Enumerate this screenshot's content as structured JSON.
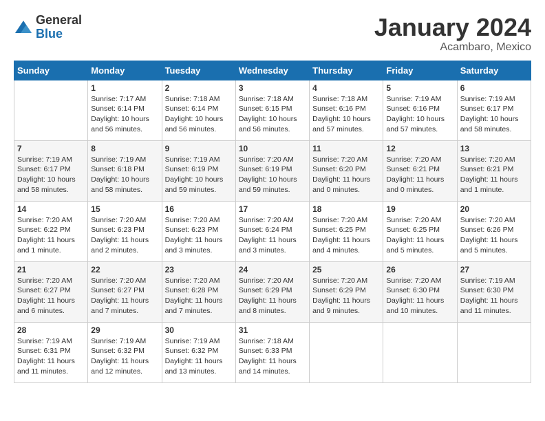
{
  "logo": {
    "general": "General",
    "blue": "Blue"
  },
  "title": "January 2024",
  "subtitle": "Acambaro, Mexico",
  "days_header": [
    "Sunday",
    "Monday",
    "Tuesday",
    "Wednesday",
    "Thursday",
    "Friday",
    "Saturday"
  ],
  "weeks": [
    [
      {
        "num": "",
        "info": ""
      },
      {
        "num": "1",
        "info": "Sunrise: 7:17 AM\nSunset: 6:14 PM\nDaylight: 10 hours\nand 56 minutes."
      },
      {
        "num": "2",
        "info": "Sunrise: 7:18 AM\nSunset: 6:14 PM\nDaylight: 10 hours\nand 56 minutes."
      },
      {
        "num": "3",
        "info": "Sunrise: 7:18 AM\nSunset: 6:15 PM\nDaylight: 10 hours\nand 56 minutes."
      },
      {
        "num": "4",
        "info": "Sunrise: 7:18 AM\nSunset: 6:16 PM\nDaylight: 10 hours\nand 57 minutes."
      },
      {
        "num": "5",
        "info": "Sunrise: 7:19 AM\nSunset: 6:16 PM\nDaylight: 10 hours\nand 57 minutes."
      },
      {
        "num": "6",
        "info": "Sunrise: 7:19 AM\nSunset: 6:17 PM\nDaylight: 10 hours\nand 58 minutes."
      }
    ],
    [
      {
        "num": "7",
        "info": "Sunrise: 7:19 AM\nSunset: 6:17 PM\nDaylight: 10 hours\nand 58 minutes."
      },
      {
        "num": "8",
        "info": "Sunrise: 7:19 AM\nSunset: 6:18 PM\nDaylight: 10 hours\nand 58 minutes."
      },
      {
        "num": "9",
        "info": "Sunrise: 7:19 AM\nSunset: 6:19 PM\nDaylight: 10 hours\nand 59 minutes."
      },
      {
        "num": "10",
        "info": "Sunrise: 7:20 AM\nSunset: 6:19 PM\nDaylight: 10 hours\nand 59 minutes."
      },
      {
        "num": "11",
        "info": "Sunrise: 7:20 AM\nSunset: 6:20 PM\nDaylight: 11 hours\nand 0 minutes."
      },
      {
        "num": "12",
        "info": "Sunrise: 7:20 AM\nSunset: 6:21 PM\nDaylight: 11 hours\nand 0 minutes."
      },
      {
        "num": "13",
        "info": "Sunrise: 7:20 AM\nSunset: 6:21 PM\nDaylight: 11 hours\nand 1 minute."
      }
    ],
    [
      {
        "num": "14",
        "info": "Sunrise: 7:20 AM\nSunset: 6:22 PM\nDaylight: 11 hours\nand 1 minute."
      },
      {
        "num": "15",
        "info": "Sunrise: 7:20 AM\nSunset: 6:23 PM\nDaylight: 11 hours\nand 2 minutes."
      },
      {
        "num": "16",
        "info": "Sunrise: 7:20 AM\nSunset: 6:23 PM\nDaylight: 11 hours\nand 3 minutes."
      },
      {
        "num": "17",
        "info": "Sunrise: 7:20 AM\nSunset: 6:24 PM\nDaylight: 11 hours\nand 3 minutes."
      },
      {
        "num": "18",
        "info": "Sunrise: 7:20 AM\nSunset: 6:25 PM\nDaylight: 11 hours\nand 4 minutes."
      },
      {
        "num": "19",
        "info": "Sunrise: 7:20 AM\nSunset: 6:25 PM\nDaylight: 11 hours\nand 5 minutes."
      },
      {
        "num": "20",
        "info": "Sunrise: 7:20 AM\nSunset: 6:26 PM\nDaylight: 11 hours\nand 5 minutes."
      }
    ],
    [
      {
        "num": "21",
        "info": "Sunrise: 7:20 AM\nSunset: 6:27 PM\nDaylight: 11 hours\nand 6 minutes."
      },
      {
        "num": "22",
        "info": "Sunrise: 7:20 AM\nSunset: 6:27 PM\nDaylight: 11 hours\nand 7 minutes."
      },
      {
        "num": "23",
        "info": "Sunrise: 7:20 AM\nSunset: 6:28 PM\nDaylight: 11 hours\nand 7 minutes."
      },
      {
        "num": "24",
        "info": "Sunrise: 7:20 AM\nSunset: 6:29 PM\nDaylight: 11 hours\nand 8 minutes."
      },
      {
        "num": "25",
        "info": "Sunrise: 7:20 AM\nSunset: 6:29 PM\nDaylight: 11 hours\nand 9 minutes."
      },
      {
        "num": "26",
        "info": "Sunrise: 7:20 AM\nSunset: 6:30 PM\nDaylight: 11 hours\nand 10 minutes."
      },
      {
        "num": "27",
        "info": "Sunrise: 7:19 AM\nSunset: 6:30 PM\nDaylight: 11 hours\nand 11 minutes."
      }
    ],
    [
      {
        "num": "28",
        "info": "Sunrise: 7:19 AM\nSunset: 6:31 PM\nDaylight: 11 hours\nand 11 minutes."
      },
      {
        "num": "29",
        "info": "Sunrise: 7:19 AM\nSunset: 6:32 PM\nDaylight: 11 hours\nand 12 minutes."
      },
      {
        "num": "30",
        "info": "Sunrise: 7:19 AM\nSunset: 6:32 PM\nDaylight: 11 hours\nand 13 minutes."
      },
      {
        "num": "31",
        "info": "Sunrise: 7:18 AM\nSunset: 6:33 PM\nDaylight: 11 hours\nand 14 minutes."
      },
      {
        "num": "",
        "info": ""
      },
      {
        "num": "",
        "info": ""
      },
      {
        "num": "",
        "info": ""
      }
    ]
  ]
}
